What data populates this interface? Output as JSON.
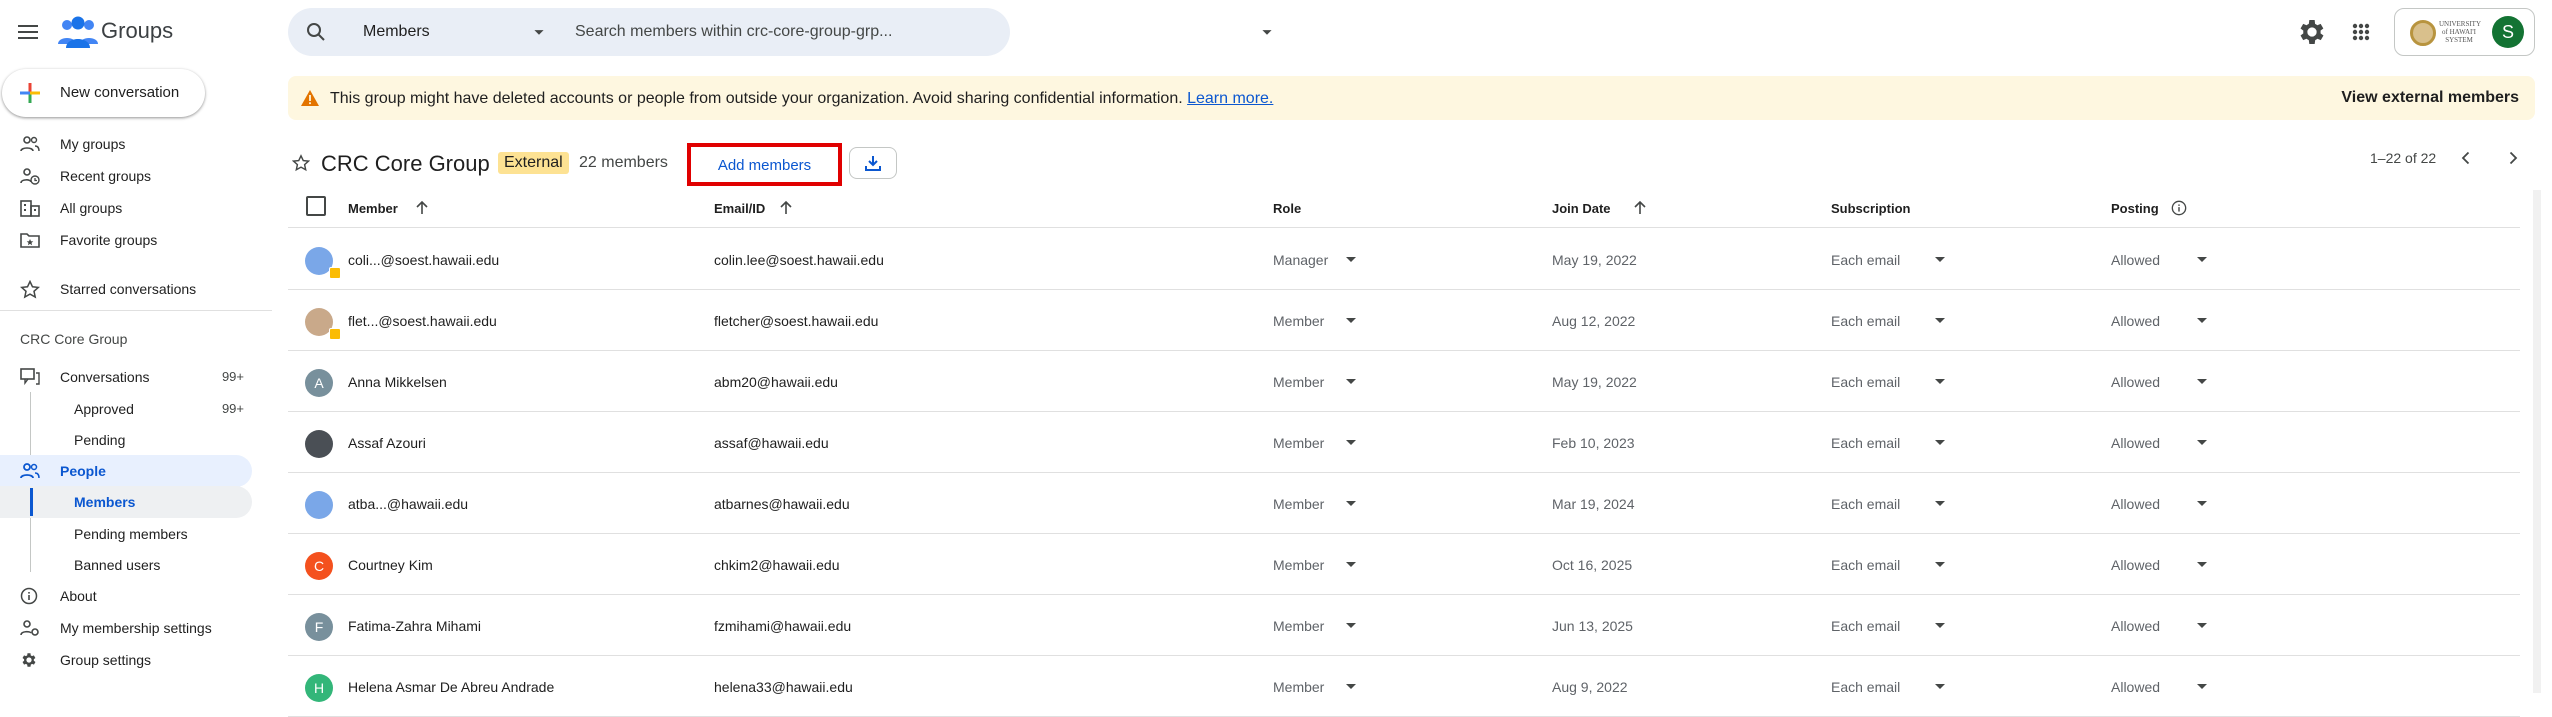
{
  "app": {
    "title": "Groups"
  },
  "search": {
    "scope": "Members",
    "placeholder": "Search members within crc-core-group-grp..."
  },
  "account": {
    "org_text": "UNIVERSITY of HAWAI'I SYSTEM",
    "avatar_letter": "S"
  },
  "sidebar": {
    "new_conversation": "New conversation",
    "top_items": [
      {
        "label": "My groups",
        "icon": "people-icon"
      },
      {
        "label": "Recent groups",
        "icon": "history-icon"
      },
      {
        "label": "All groups",
        "icon": "building-icon"
      },
      {
        "label": "Favorite groups",
        "icon": "folder-star-icon"
      },
      {
        "label": "Starred conversations",
        "icon": "star-icon"
      }
    ],
    "section_title": "CRC Core Group",
    "conversations": {
      "label": "Conversations",
      "count": "99+"
    },
    "approved": {
      "label": "Approved",
      "count": "99+"
    },
    "pending": {
      "label": "Pending"
    },
    "people": {
      "label": "People"
    },
    "members": {
      "label": "Members"
    },
    "pending_members": {
      "label": "Pending members"
    },
    "banned_users": {
      "label": "Banned users"
    },
    "about": {
      "label": "About"
    },
    "membership_settings": {
      "label": "My membership settings"
    },
    "group_settings": {
      "label": "Group settings"
    }
  },
  "banner": {
    "message": "This group might have deleted accounts or people from outside your organization. Avoid sharing confidential information.",
    "link": "Learn more.",
    "action": "View external members"
  },
  "group": {
    "title": "CRC Core Group",
    "badge": "External",
    "member_count": "22 members",
    "add_members": "Add members",
    "pager": "1–22 of 22"
  },
  "table": {
    "headers": {
      "member": "Member",
      "email": "Email/ID",
      "role": "Role",
      "join_date": "Join Date",
      "subscription": "Subscription",
      "posting": "Posting"
    },
    "rows": [
      {
        "name": "coli...@soest.hawaii.edu",
        "email": "colin.lee@soest.hawaii.edu",
        "role": "Manager",
        "join_date": "May 19, 2022",
        "subscription": "Each email",
        "posting": "Allowed",
        "avatar": "",
        "avatar_color": "#7aa7e8",
        "external": true
      },
      {
        "name": "flet...@soest.hawaii.edu",
        "email": "fletcher@soest.hawaii.edu",
        "role": "Member",
        "join_date": "Aug 12, 2022",
        "subscription": "Each email",
        "posting": "Allowed",
        "avatar": "",
        "avatar_color": "#c9a98a",
        "external": true
      },
      {
        "name": "Anna Mikkelsen",
        "email": "abm20@hawaii.edu",
        "role": "Member",
        "join_date": "May 19, 2022",
        "subscription": "Each email",
        "posting": "Allowed",
        "avatar": "A",
        "avatar_color": "#78909c",
        "external": false
      },
      {
        "name": "Assaf Azouri",
        "email": "assaf@hawaii.edu",
        "role": "Member",
        "join_date": "Feb 10, 2023",
        "subscription": "Each email",
        "posting": "Allowed",
        "avatar": "",
        "avatar_color": "#4a4f55",
        "external": false
      },
      {
        "name": "atba...@hawaii.edu",
        "email": "atbarnes@hawaii.edu",
        "role": "Member",
        "join_date": "Mar 19, 2024",
        "subscription": "Each email",
        "posting": "Allowed",
        "avatar": "",
        "avatar_color": "#7aa7e8",
        "external": false
      },
      {
        "name": "Courtney Kim",
        "email": "chkim2@hawaii.edu",
        "role": "Member",
        "join_date": "Oct 16, 2025",
        "subscription": "Each email",
        "posting": "Allowed",
        "avatar": "C",
        "avatar_color": "#f4511e",
        "external": false
      },
      {
        "name": "Fatima-Zahra Mihami",
        "email": "fzmihami@hawaii.edu",
        "role": "Member",
        "join_date": "Jun 13, 2025",
        "subscription": "Each email",
        "posting": "Allowed",
        "avatar": "F",
        "avatar_color": "#78909c",
        "external": false
      },
      {
        "name": "Helena Asmar De Abreu Andrade",
        "email": "helena33@hawaii.edu",
        "role": "Member",
        "join_date": "Aug 9, 2022",
        "subscription": "Each email",
        "posting": "Allowed",
        "avatar": "H",
        "avatar_color": "#33b679",
        "external": false
      }
    ]
  }
}
